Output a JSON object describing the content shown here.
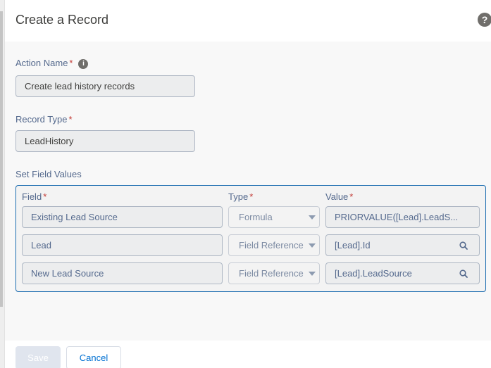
{
  "header": {
    "title": "Create a Record",
    "help_icon": "question-circle-icon"
  },
  "form": {
    "action_name": {
      "label": "Action Name",
      "required_marker": "*",
      "info_icon": "info-icon",
      "value": "Create lead history records"
    },
    "record_type": {
      "label": "Record Type",
      "required_marker": "*",
      "value": "LeadHistory"
    },
    "field_values": {
      "section_label": "Set Field Values",
      "columns": [
        {
          "label": "Field",
          "required_marker": "*"
        },
        {
          "label": "Type",
          "required_marker": "*"
        },
        {
          "label": "Value",
          "required_marker": "*"
        }
      ],
      "rows": [
        {
          "field": "Existing Lead Source",
          "type": "Formula",
          "value": "PRIORVALUE([Lead].LeadS...",
          "value_icon": ""
        },
        {
          "field": "Lead",
          "type": "Field Reference",
          "value": "[Lead].Id",
          "value_icon": "search-icon"
        },
        {
          "field": "New Lead Source",
          "type": "Field Reference",
          "value": "[Lead].LeadSource",
          "value_icon": "search-icon"
        }
      ]
    }
  },
  "footer": {
    "save_label": "Save",
    "cancel_label": "Cancel"
  }
}
